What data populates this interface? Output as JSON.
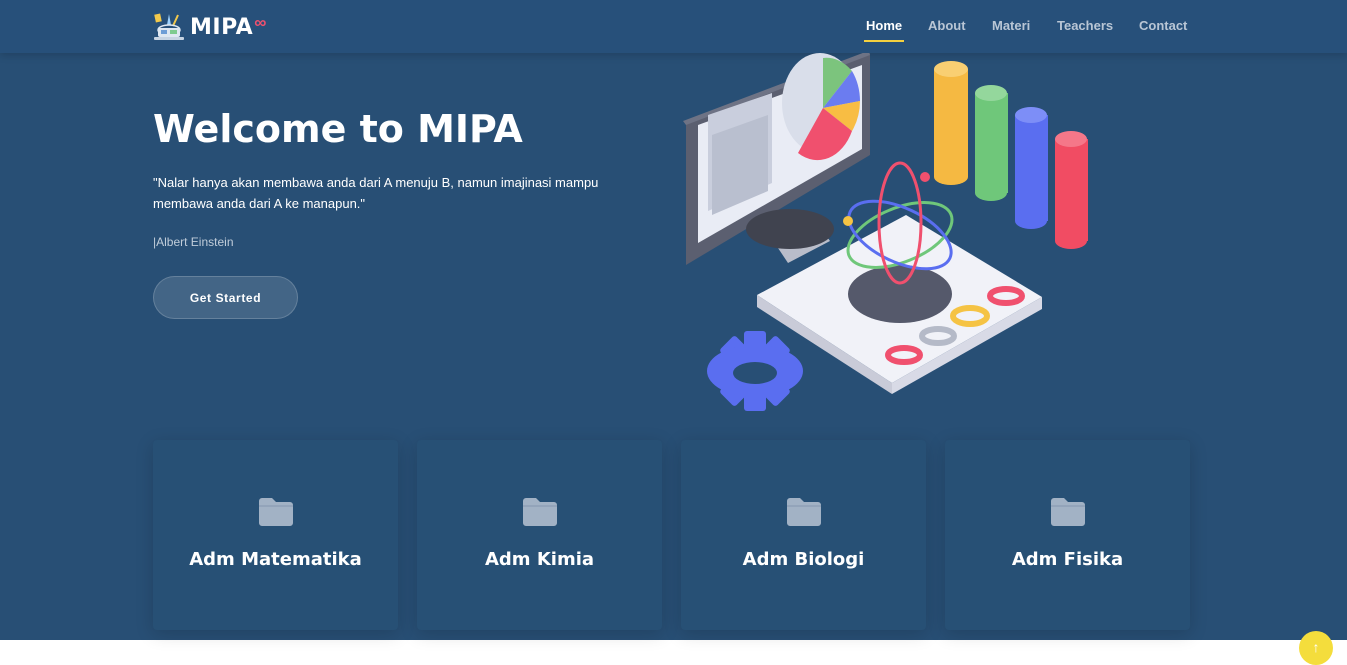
{
  "brand": {
    "name": "MIPA",
    "suffix": "∞"
  },
  "nav": {
    "items": [
      {
        "label": "Home",
        "active": true
      },
      {
        "label": "About",
        "active": false
      },
      {
        "label": "Materi",
        "active": false
      },
      {
        "label": "Teachers",
        "active": false
      },
      {
        "label": "Contact",
        "active": false
      }
    ]
  },
  "hero": {
    "title": "Welcome to MIPA",
    "quote": "\"Nalar hanya akan membawa anda dari A menuju B, namun imajinasi mampu membawa anda dari A ke manapun.\"",
    "author": "|Albert Einstein",
    "cta_label": "Get Started",
    "illustration": "science-lab-illustration"
  },
  "cards": [
    {
      "label": "Adm Matematika",
      "icon": "folder-icon"
    },
    {
      "label": "Adm Kimia",
      "icon": "folder-icon"
    },
    {
      "label": "Adm Biologi",
      "icon": "folder-icon"
    },
    {
      "label": "Adm Fisika",
      "icon": "folder-icon"
    }
  ],
  "back_to_top": {
    "icon": "arrow-up-icon",
    "glyph": "↑"
  },
  "colors": {
    "hero_bg": "#284f75",
    "nav_bg": "#27507a",
    "accent_underline": "#f4d03f",
    "back_to_top": "#f4dd3c",
    "folder": "#a2b2c5"
  }
}
